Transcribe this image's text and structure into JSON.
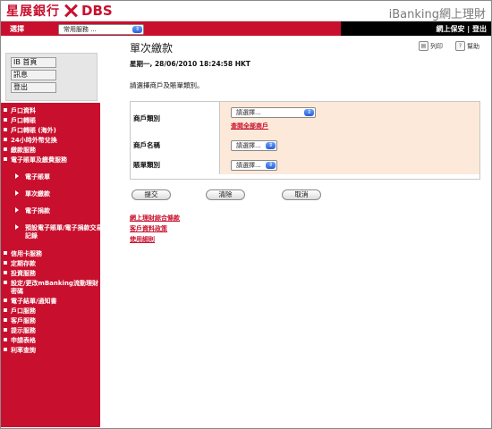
{
  "header": {
    "logo_cn": "星展銀行",
    "logo_en": "DBS",
    "right_brand": "iBanking網上理財"
  },
  "strip": {
    "label": "選擇",
    "selector_value": "常用服務 ...",
    "right_links": "網上保安 | 登出"
  },
  "sidebar": {
    "buttons": [
      "IB 首頁",
      "訊息",
      "登出"
    ],
    "menu_top": [
      "戶口資料",
      "戶口轉賬",
      "戶口轉賬 (海外)",
      "24小時外幣兌換",
      "繳款服務",
      "電子賬單及繳費服務"
    ],
    "submenu": [
      "電子賬單",
      "單次繳款",
      "電子捐款",
      "預設電子賬單/電子捐款交易記錄"
    ],
    "menu_bottom": [
      "信用卡服務",
      "定期存款",
      "投資服務",
      "設定/更改mBanking流動理財密碼",
      "電子結單/通知書",
      "戶口服務",
      "客戶服務",
      "提示服務",
      "申請表格",
      "利率查詢"
    ]
  },
  "main": {
    "title": "單次繳款",
    "print_label": "列印",
    "help_label": "幫助",
    "datetime": "星期一, 28/06/2010 18:24:58 HKT",
    "instruction": "請選擇商戶及賬單類別。",
    "form": {
      "merchant_type_label": "商戶類別",
      "merchant_type_value": "請選擇...",
      "view_all_link": "查閱全部商戶",
      "merchant_name_label": "商戶名稱",
      "merchant_name_value": "請選擇...",
      "bill_type_label": "賬單類別",
      "bill_type_value": "請選擇..."
    },
    "buttons": {
      "submit": "提交",
      "clear": "清除",
      "cancel": "取消"
    },
    "links": [
      "網上理財綜合條款",
      "客戶資料政策",
      "使用細則"
    ]
  },
  "colors": {
    "brand_red": "#c8102e",
    "form_bg": "#fde9d9"
  },
  "icons": {
    "select_arrow": "blue-select-arrow",
    "print": "print-icon",
    "help": "help-icon"
  }
}
